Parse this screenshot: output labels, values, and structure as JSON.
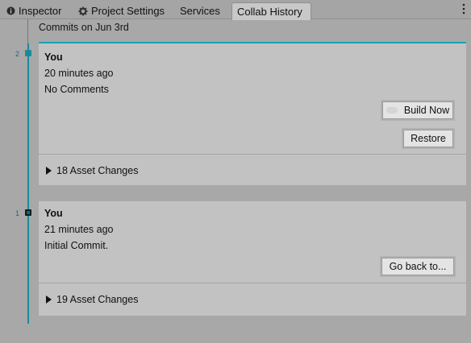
{
  "tabs": [
    {
      "label": "Inspector",
      "icon": "info-icon"
    },
    {
      "label": "Project Settings",
      "icon": "gear-icon"
    },
    {
      "label": "Services"
    },
    {
      "label": "Collab History",
      "active": true
    }
  ],
  "menu_icon": "kebab-menu-icon",
  "timeline": {
    "date_header": "Commits on Jun 3rd",
    "accent_color": "#1a8a9a"
  },
  "commits": [
    {
      "number": "2",
      "author": "You",
      "time": "20 minutes ago",
      "message": "No Comments",
      "build_label": "Build Now",
      "restore_label": "Restore",
      "changes": "18 Asset Changes"
    },
    {
      "number": "1",
      "author": "You",
      "time": "21 minutes ago",
      "message": "Initial Commit.",
      "goback_label": "Go back to...",
      "changes": "19 Asset Changes"
    }
  ]
}
